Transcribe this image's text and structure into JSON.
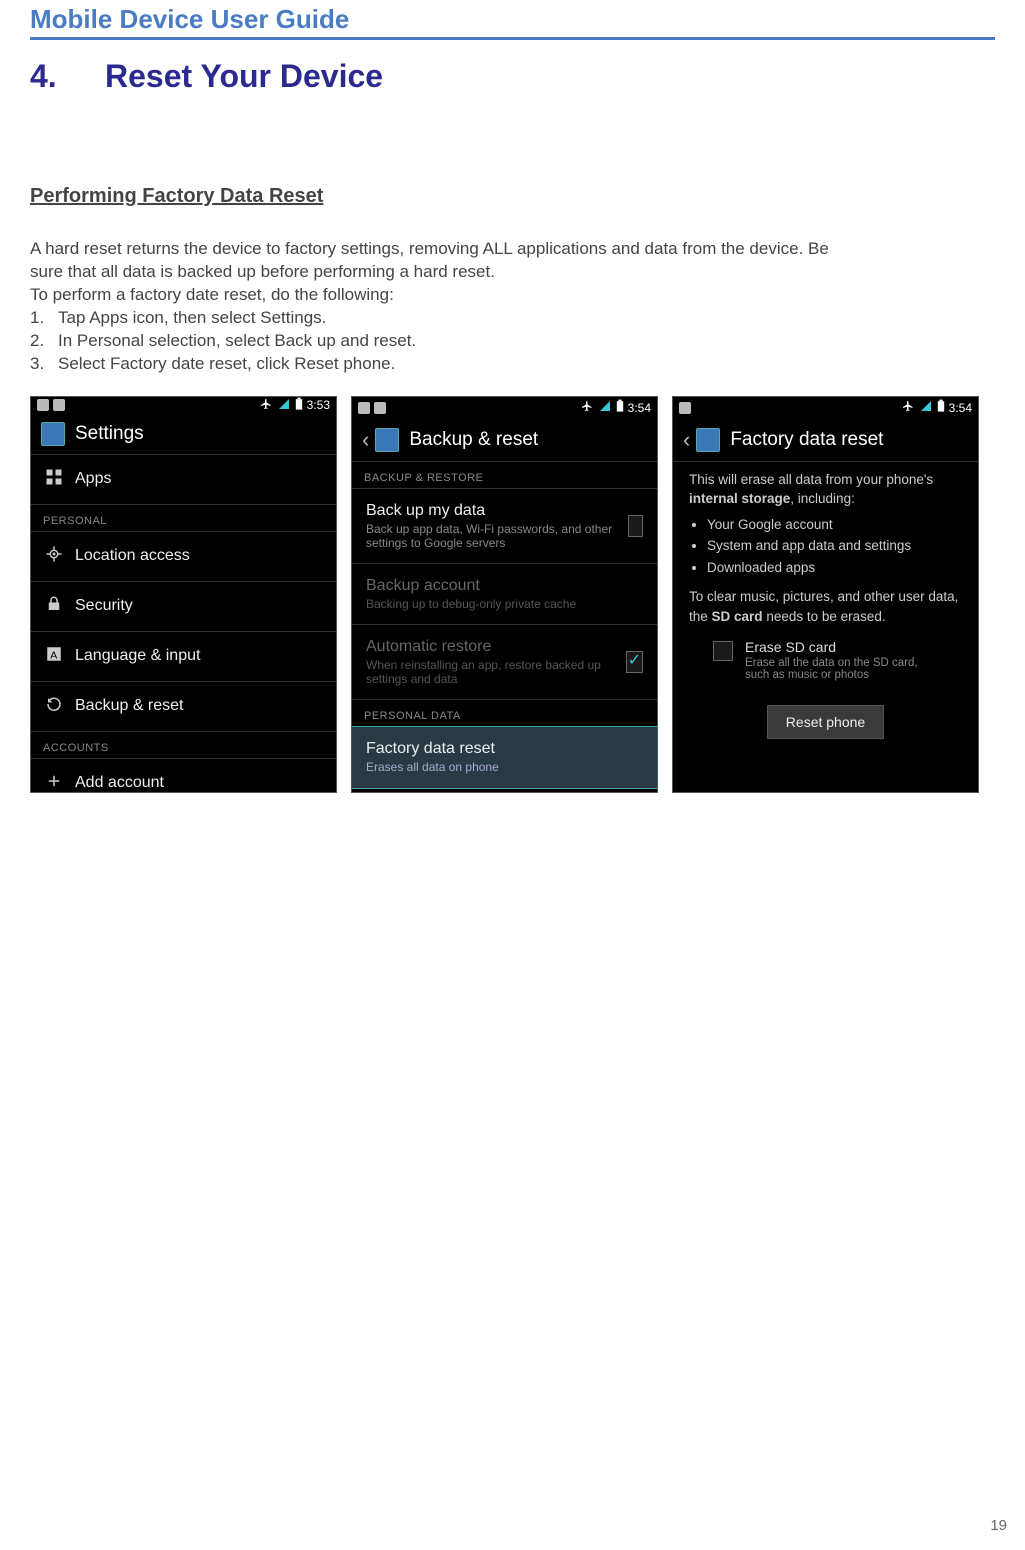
{
  "header": {
    "title": "Mobile Device User Guide"
  },
  "chapter": {
    "num": "4.",
    "title": "Reset Your Device"
  },
  "subhead": "Performing Factory Data Reset",
  "body": {
    "intro1": "A hard reset returns the device to factory settings, removing ALL applications and data from the device. Be sure that all data is backed up before performing a hard reset.",
    "intro2": "To perform a factory date reset, do the following:",
    "steps": [
      {
        "n": "1.",
        "t": "Tap Apps icon, then select Settings."
      },
      {
        "n": "2.",
        "t": "In Personal selection, select Back up and reset."
      },
      {
        "n": "3.",
        "t": "Select Factory date reset, click Reset phone."
      }
    ]
  },
  "shots": {
    "s1": {
      "time": "3:53",
      "title": "Settings",
      "rows": [
        {
          "label": "Apps"
        },
        {
          "section": "PERSONAL"
        },
        {
          "label": "Location access"
        },
        {
          "label": "Security"
        },
        {
          "label": "Language & input"
        },
        {
          "label": "Backup & reset"
        },
        {
          "section": "ACCOUNTS"
        },
        {
          "label": "Add account"
        }
      ]
    },
    "s2": {
      "time": "3:54",
      "title": "Backup & reset",
      "sections": {
        "a": "BACKUP & RESTORE",
        "b": "PERSONAL DATA"
      },
      "rows": {
        "backup": {
          "t": "Back up my data",
          "s": "Back up app data, Wi-Fi passwords, and other settings to Google servers"
        },
        "acct": {
          "t": "Backup account",
          "s": "Backing up to debug-only private cache"
        },
        "auto": {
          "t": "Automatic restore",
          "s": "When reinstalling an app, restore backed up settings and data"
        },
        "fdr": {
          "t": "Factory data reset",
          "s": "Erases all data on phone"
        }
      }
    },
    "s3": {
      "time": "3:54",
      "title": "Factory data reset",
      "para1a": "This will erase all data from your phone's ",
      "para1b": "internal storage",
      "para1c": ", including:",
      "bullets": [
        "Your Google account",
        "System and app data and settings",
        "Downloaded apps"
      ],
      "para2a": "To clear music, pictures, and other user data, the ",
      "para2b": "SD card",
      "para2c": " needs to be erased.",
      "erase": {
        "t": "Erase SD card",
        "s": "Erase all the data on the SD card, such as music or photos"
      },
      "btn": "Reset phone"
    }
  },
  "pagenum": "19"
}
